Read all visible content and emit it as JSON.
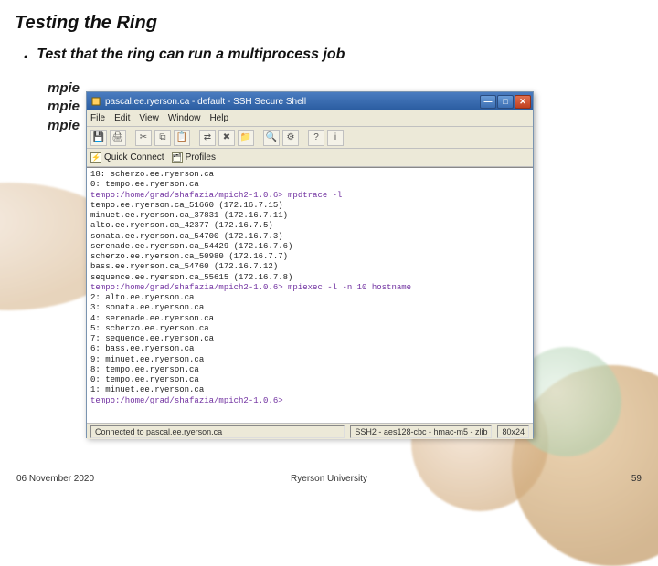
{
  "slide": {
    "title": "Testing the Ring",
    "bullet": "Test that the ring can run a multiprocess job",
    "mpi_lines": [
      "mpie",
      "mpie",
      "mpie"
    ]
  },
  "footer": {
    "left": "06 November 2020",
    "center": "Ryerson University",
    "right": "59"
  },
  "ssh": {
    "title": "pascal.ee.ryerson.ca - default - SSH Secure Shell",
    "menus": [
      "File",
      "Edit",
      "View",
      "Window",
      "Help"
    ],
    "quick_connect": "Quick Connect",
    "profiles": "Profiles",
    "status_connected": "Connected to pascal.ee.ryerson.ca",
    "status_ssh": "SSH2 - aes128-cbc - hmac-m5 - zlib",
    "status_size": "80x24",
    "terminal_lines": [
      {
        "kind": "out",
        "text": "18: scherzo.ee.ryerson.ca"
      },
      {
        "kind": "out",
        "text": "0: tempo.ee.ryerson.ca"
      },
      {
        "kind": "prompt",
        "text": "tempo:/home/grad/shafazia/mpich2-1.0.6> mpdtrace -l"
      },
      {
        "kind": "out",
        "text": "tempo.ee.ryerson.ca_51660 (172.16.7.15)"
      },
      {
        "kind": "out",
        "text": "minuet.ee.ryerson.ca_37831 (172.16.7.11)"
      },
      {
        "kind": "out",
        "text": "alto.ee.ryerson.ca_42377 (172.16.7.5)"
      },
      {
        "kind": "out",
        "text": "sonata.ee.ryerson.ca_54700 (172.16.7.3)"
      },
      {
        "kind": "out",
        "text": "serenade.ee.ryerson.ca_54429 (172.16.7.6)"
      },
      {
        "kind": "out",
        "text": "scherzo.ee.ryerson.ca_50980 (172.16.7.7)"
      },
      {
        "kind": "out",
        "text": "bass.ee.ryerson.ca_54760 (172.16.7.12)"
      },
      {
        "kind": "out",
        "text": "sequence.ee.ryerson.ca_55615 (172.16.7.8)"
      },
      {
        "kind": "prompt",
        "text": "tempo:/home/grad/shafazia/mpich2-1.0.6> mpiexec -l -n 10 hostname"
      },
      {
        "kind": "out",
        "text": "2: alto.ee.ryerson.ca"
      },
      {
        "kind": "out",
        "text": "3: sonata.ee.ryerson.ca"
      },
      {
        "kind": "out",
        "text": "4: serenade.ee.ryerson.ca"
      },
      {
        "kind": "out",
        "text": "5: scherzo.ee.ryerson.ca"
      },
      {
        "kind": "out",
        "text": "7: sequence.ee.ryerson.ca"
      },
      {
        "kind": "out",
        "text": "6: bass.ee.ryerson.ca"
      },
      {
        "kind": "out",
        "text": "9: minuet.ee.ryerson.ca"
      },
      {
        "kind": "out",
        "text": "8: tempo.ee.ryerson.ca"
      },
      {
        "kind": "out",
        "text": "0: tempo.ee.ryerson.ca"
      },
      {
        "kind": "out",
        "text": "1: minuet.ee.ryerson.ca"
      },
      {
        "kind": "prompt",
        "text": "tempo:/home/grad/shafazia/mpich2-1.0.6>"
      }
    ]
  }
}
